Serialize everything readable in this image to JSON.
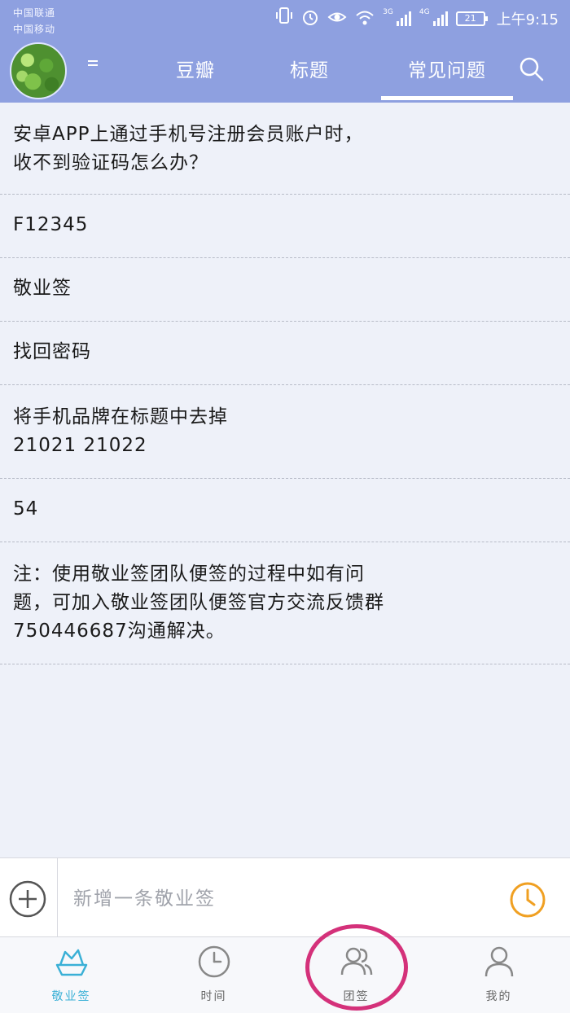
{
  "status_bar": {
    "carrier_1": "中国联通",
    "carrier_2": "中国移动",
    "net_1": "3G",
    "net_2": "4G",
    "battery": "21",
    "time": "上午9:15"
  },
  "header": {
    "tabs": [
      {
        "label": "豆瓣"
      },
      {
        "label": "标题"
      },
      {
        "label": "常见问题",
        "active": true
      }
    ]
  },
  "list": {
    "items": [
      {
        "text": "安卓APP上通过手机号注册会员账户时，\n收不到验证码怎么办？"
      },
      {
        "text": "F12345"
      },
      {
        "text": "敬业签"
      },
      {
        "text": "找回密码"
      },
      {
        "text": "将手机品牌在标题中去掉\n21021  21022"
      },
      {
        "text": "54"
      },
      {
        "text": "注：使用敬业签团队便签的过程中如有问\n题，可加入敬业签团队便签官方交流反馈群\n750446687沟通解决。"
      }
    ]
  },
  "input_bar": {
    "placeholder": "新增一条敬业签"
  },
  "bottom_nav": {
    "items": [
      {
        "label": "敬业签",
        "icon": "boat-icon",
        "active": true
      },
      {
        "label": "时间",
        "icon": "clock-icon"
      },
      {
        "label": "团签",
        "icon": "group-icon"
      },
      {
        "label": "我的",
        "icon": "person-icon"
      }
    ]
  },
  "colors": {
    "header_bg": "#8ea0e0",
    "page_bg": "#eef1f9",
    "accent_blue": "#3ab0d6",
    "clock_orange": "#f0a022",
    "highlight_ring": "#d4317a"
  }
}
